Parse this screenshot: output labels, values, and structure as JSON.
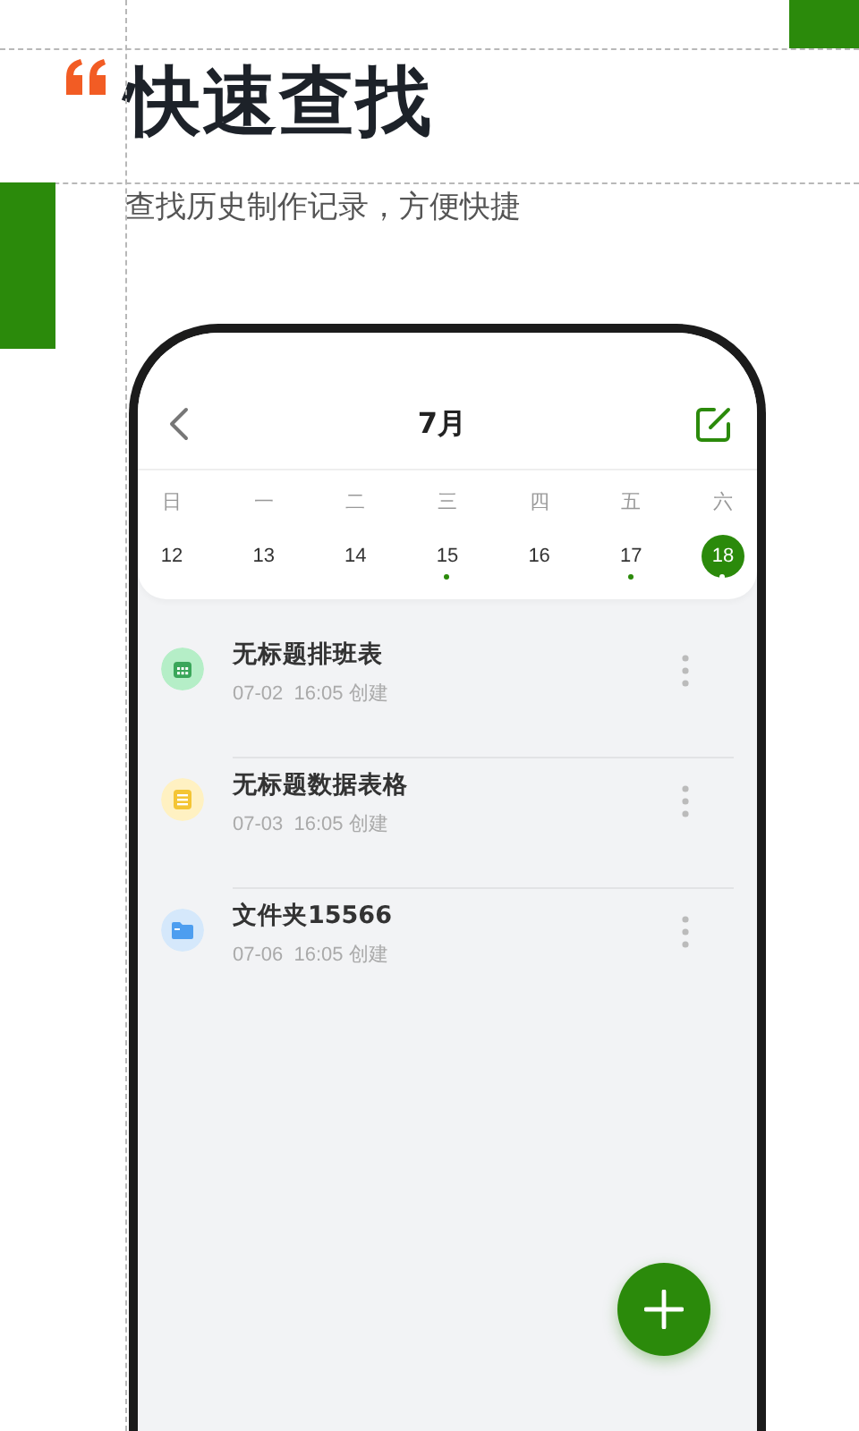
{
  "promo": {
    "title": "快速查找",
    "subtitle": "查找历史制作记录，方便快捷"
  },
  "header": {
    "title": "7月"
  },
  "weekdays": [
    "日",
    "一",
    "二",
    "三",
    "四",
    "五",
    "六"
  ],
  "dates": [
    {
      "day": "12",
      "has_event": false,
      "selected": false
    },
    {
      "day": "13",
      "has_event": false,
      "selected": false
    },
    {
      "day": "14",
      "has_event": false,
      "selected": false
    },
    {
      "day": "15",
      "has_event": true,
      "selected": false
    },
    {
      "day": "16",
      "has_event": false,
      "selected": false
    },
    {
      "day": "17",
      "has_event": true,
      "selected": false
    },
    {
      "day": "18",
      "has_event": true,
      "selected": true
    }
  ],
  "files": [
    {
      "kind": "schedule",
      "title": "无标题排班表",
      "date": "07-02",
      "time": "16:05",
      "note": "创建"
    },
    {
      "kind": "sheet",
      "title": "无标题数据表格",
      "date": "07-03",
      "time": "16:05",
      "note": "创建"
    },
    {
      "kind": "folder",
      "title": "文件夹15566",
      "date": "07-06",
      "time": "16:05",
      "note": "创建"
    }
  ]
}
